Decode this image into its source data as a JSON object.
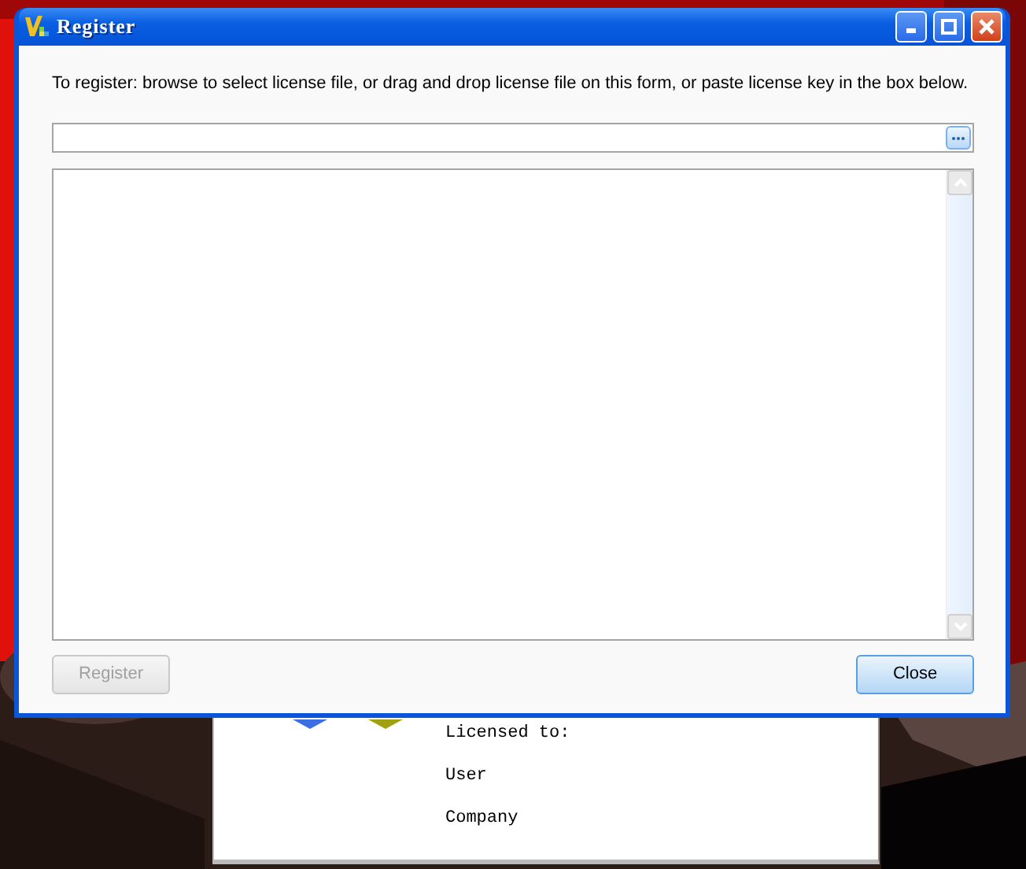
{
  "dialog": {
    "title": "Register",
    "instruction": "To register: browse to select license file, or drag and drop license file on this form, or paste license key in the box below.",
    "buttons": [
      {
        "label": "Register",
        "disabled": true
      },
      {
        "label": "Close",
        "disabled": false
      }
    ]
  },
  "background_window": {
    "lines": [
      "Licensed to:",
      "User",
      "Company"
    ]
  }
}
